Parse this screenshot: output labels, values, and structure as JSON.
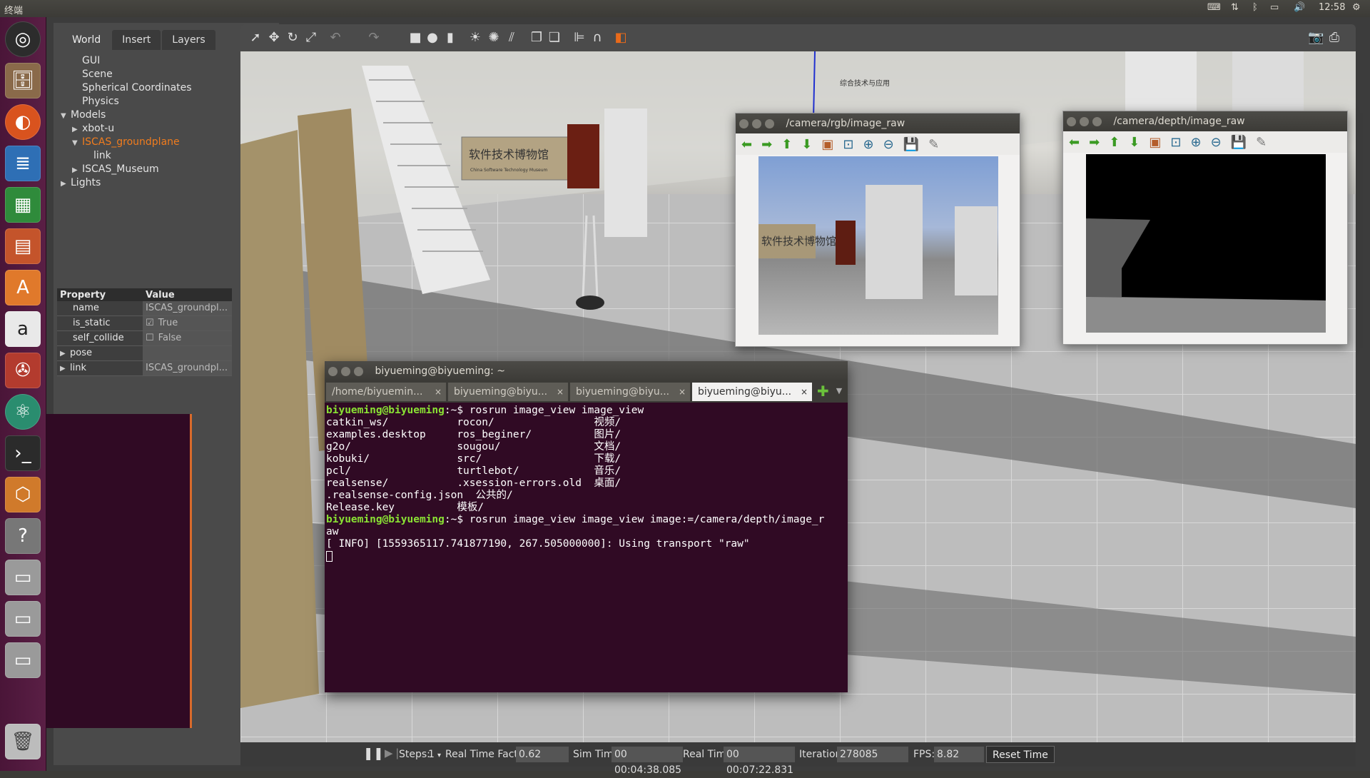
{
  "topbar": {
    "title": "终端",
    "time": "12:58"
  },
  "launcher": {
    "icons": [
      "ubuntu-dash-icon",
      "files-icon",
      "firefox-icon",
      "writer-icon",
      "calc-icon",
      "impress-icon",
      "software-center-icon",
      "amazon-icon",
      "settings-icon",
      "atom-icon",
      "terminal-icon",
      "virtualbox-icon",
      "help-icon",
      "drive-icon",
      "drive-icon",
      "drive-icon",
      "trash-icon"
    ]
  },
  "gazebo": {
    "tabs": [
      "World",
      "Insert",
      "Layers"
    ],
    "tree": [
      {
        "label": "GUI",
        "indent": 1,
        "arrow": ""
      },
      {
        "label": "Scene",
        "indent": 1,
        "arrow": ""
      },
      {
        "label": "Spherical Coordinates",
        "indent": 1,
        "arrow": ""
      },
      {
        "label": "Physics",
        "indent": 1,
        "arrow": ""
      },
      {
        "label": "Models",
        "indent": 0,
        "arrow": "▼"
      },
      {
        "label": "xbot-u",
        "indent": 1,
        "arrow": "▶"
      },
      {
        "label": "ISCAS_groundplane",
        "indent": 1,
        "arrow": "▼",
        "selected": true
      },
      {
        "label": "link",
        "indent": 2,
        "arrow": ""
      },
      {
        "label": "ISCAS_Museum",
        "indent": 1,
        "arrow": "▶"
      },
      {
        "label": "Lights",
        "indent": 0,
        "arrow": "▶"
      }
    ],
    "property_header": {
      "key": "Property",
      "value": "Value"
    },
    "properties": [
      {
        "key": "name",
        "value": "ISCAS_groundpl..."
      },
      {
        "key": "is_static",
        "value": "True",
        "check": "☑"
      },
      {
        "key": "self_collide",
        "value": "False",
        "check": "☐"
      },
      {
        "key": "pose",
        "value": "",
        "arrow": "▶"
      },
      {
        "key": "link",
        "value": "ISCAS_groundpl...",
        "arrow": "▶"
      }
    ],
    "bottom": {
      "steps_label": "Steps:",
      "steps_value": "1",
      "rtf_label": "Real Time Factor:",
      "rtf_value": "0.62",
      "sim_label": "Sim Time:",
      "sim_value": "00 00:04:38.085",
      "real_label": "Real Time:",
      "real_value": "00 00:07:22.831",
      "iter_label": "Iterations:",
      "iter_value": "278085",
      "fps_label": "FPS:",
      "fps_value": "8.82",
      "reset_label": "Reset Time"
    }
  },
  "rgb_window": {
    "title": "/camera/rgb/image_raw",
    "sign_text": "软件技术博物馆"
  },
  "depth_window": {
    "title": "/camera/depth/image_raw"
  },
  "scene": {
    "museum_sign": "软件技术博物馆",
    "museum_sign_en": "China Software Technology Museum",
    "banner": "综合技术与应用"
  },
  "terminal": {
    "title": "biyueming@biyueming: ~",
    "tabs": [
      "/home/biyuemin...",
      "biyueming@biyu...",
      "biyueming@biyu...",
      "biyueming@biyu..."
    ],
    "prompt": "biyueming@biyueming",
    "cmd1": ":~$ rosrun image_view image_view",
    "ls_lines": [
      "catkin_ws/           rocon/                视频/",
      "examples.desktop     ros_beginer/          图片/",
      "g2o/                 sougou/               文档/",
      "kobuki/              src/                  下载/",
      "pcl/                 turtlebot/            音乐/",
      "realsense/           .xsession-errors.old  桌面/",
      ".realsense-config.json  公共的/",
      "Release.key          模板/"
    ],
    "cmd2": ":~$ rosrun image_view image_view image:=/camera/depth/image_r",
    "cmd2_wrap": "aw",
    "info": "[ INFO] [1559365117.741877190, 267.505000000]: Using transport \"raw\""
  }
}
